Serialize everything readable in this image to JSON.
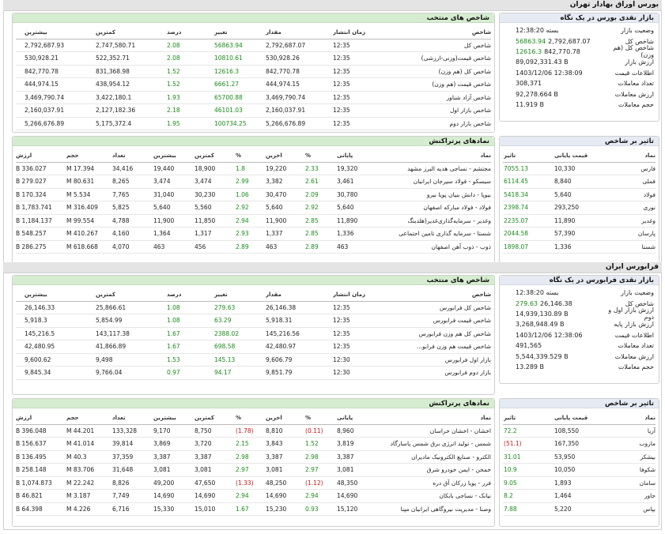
{
  "bourse": {
    "title": "بورس اوراق بهادار تهران",
    "market": {
      "title": "بازار نقدی بورس در یک نگاه",
      "rows": [
        {
          "label": "وضعیت بازار",
          "value": "بسته 12:38:20"
        },
        {
          "label": "شاخص کل",
          "value": "2,792,687.07",
          "change": "56863.94"
        },
        {
          "label": "شاخص کل (هم وزن)",
          "value": "842,770.78",
          "change": "12616.3"
        },
        {
          "label": "ارزش بازار",
          "value": "89,092,331.43 B"
        },
        {
          "label": "اطلاعات قیمت",
          "value": "1403/12/06 12:38:09"
        },
        {
          "label": "تعداد معاملات",
          "value": "308,371"
        },
        {
          "label": "ارزش معاملات",
          "value": "92,278.664 B"
        },
        {
          "label": "حجم معاملات",
          "value": "11.919 B"
        }
      ]
    },
    "indices": {
      "title": "شاخص های منتخب",
      "headers": [
        "شاخص",
        "زمان انتشار",
        "مقدار",
        "تغییر",
        "درصد",
        "کمترین",
        "بیشترین"
      ],
      "rows": [
        [
          "شاخص کل",
          "12:35",
          "2,792,687.07",
          "56863.94",
          "2.08",
          "2,747,580.71",
          "2,792,687.93"
        ],
        [
          "شاخص قیمت(وزنی-ارزشی)",
          "12:35",
          "530,928.26",
          "10810.61",
          "2.08",
          "522,352.71",
          "530,928.21"
        ],
        [
          "شاخص کل (هم وزن)",
          "12:35",
          "842,770.78",
          "12616.3",
          "1.52",
          "831,368.98",
          "842,770.78"
        ],
        [
          "شاخص قیمت (هم وزن)",
          "12:35",
          "444,974.15",
          "6661.27",
          "1.52",
          "438,954.12",
          "444,974.15"
        ],
        [
          "شاخص آزاد شناور",
          "12:35",
          "3,469,790.74",
          "65700.88",
          "1.93",
          "3,422,180.1",
          "3,469,790.74"
        ],
        [
          "شاخص بازار اول",
          "12:35",
          "2,160,037.91",
          "46101.03",
          "2.18",
          "2,127,182.36",
          "2,160,037.91"
        ],
        [
          "شاخص بازار دوم",
          "12:35",
          "5,266,676.89",
          "100734.25",
          "1.95",
          "5,175,372.4",
          "5,266,676.89"
        ]
      ]
    },
    "impact": {
      "title": "تاثیر بر شاخص",
      "headers": [
        "نماد",
        "قیمت پایانی",
        "تاثیر"
      ],
      "rows": [
        [
          "فارس",
          "10,330",
          "7055.13"
        ],
        [
          "فملی",
          "8,840",
          "6114.45"
        ],
        [
          "فولاد",
          "5,640",
          "5418.34"
        ],
        [
          "نوری",
          "293,250",
          "2398.74"
        ],
        [
          "وغدیر",
          "11,890",
          "2235.07"
        ],
        [
          "پارسان",
          "57,390",
          "2044.58"
        ],
        [
          "شستا",
          "1,336",
          "1898.07"
        ]
      ]
    },
    "popular": {
      "title": "نمادهای پرتراکنش",
      "headers": [
        "نماد",
        "پایانی",
        "%",
        "آخرین",
        "%",
        "کمترین",
        "بیشترین",
        "تعداد",
        "حجم",
        "ارزش"
      ],
      "rows": [
        [
          "مجتشم - نساجی هدیه البرز مشهد",
          "19,320",
          "2.33",
          "19,220",
          "1.8",
          "18,900",
          "19,440",
          "34,416",
          "17.394 M",
          "336.027 B"
        ],
        [
          "سیسکو - فولاد سیرجان ایرانیان",
          "3,461",
          "2.61",
          "3,382",
          "2.99",
          "3,474",
          "3,474",
          "8,265",
          "80.631 M",
          "279.027 B"
        ],
        [
          "بیوپا - دانش بنیان پویا نیرو",
          "30,780",
          "2.09",
          "30,470",
          "1.06",
          "30,230",
          "31,040",
          "7,765",
          "5.534 M",
          "170.324 B"
        ],
        [
          "فولاد - فولاد مبارکه اصفهان",
          "5,640",
          "2.92",
          "5,640",
          "2.92",
          "5,560",
          "5,640",
          "5,825",
          "316.409 M",
          "1,783.741 B"
        ],
        [
          "وغدیر - سرمایه‌گذاری‌غدیر(هلدینگ",
          "11,890",
          "2.85",
          "11,900",
          "2.94",
          "11,850",
          "11,900",
          "4,788",
          "99.554 M",
          "1,184.137 B"
        ],
        [
          "شستا - سرمایه گذاری تامین اجتماعی",
          "1,336",
          "2.85",
          "1,337",
          "2.93",
          "1,317",
          "1,364",
          "4,160",
          "410.267 M",
          "548.257 B"
        ],
        [
          "ذوب - ذوب آهن اصفهان",
          "463",
          "2.89",
          "463",
          "2.89",
          "456",
          "463",
          "4,070",
          "618.668 M",
          "286.275 B"
        ]
      ]
    }
  },
  "farabourse": {
    "title": "فرابورس ایران",
    "market": {
      "title": "بازار نقدی فرابورس در یک نگاه",
      "rows": [
        {
          "label": "وضعیت بازار",
          "value": "بسته 12:38:20"
        },
        {
          "label": "شاخص کل",
          "value": "26,146.38",
          "change": "279.63"
        },
        {
          "label": "ارزش بازار اول و دوم",
          "value": "14,939,130.89 B"
        },
        {
          "label": "ارزش بازار پایه",
          "value": "3,268,948.49 B"
        },
        {
          "label": "اطلاعات قیمت",
          "value": "1403/12/06 12:38:06"
        },
        {
          "label": "تعداد معاملات",
          "value": "491,565"
        },
        {
          "label": "ارزش معاملات",
          "value": "5,544,339.529 B"
        },
        {
          "label": "حجم معاملات",
          "value": "13.289 B"
        }
      ]
    },
    "indices": {
      "title": "شاخص های منتخب",
      "headers": [
        "شاخص",
        "زمان انتشار",
        "مقدار",
        "تغییر",
        "درصد",
        "کمترین",
        "بیشترین"
      ],
      "rows": [
        [
          "شاخص کل فرابورس",
          "12:35",
          "26,146.38",
          "279.63",
          "1.08",
          "25,866.61",
          "26,146.33"
        ],
        [
          "شاخص قیمت فرابورس",
          "12:35",
          "5,918.31",
          "63.29",
          "1.08",
          "5,854.99",
          "5,918.3"
        ],
        [
          "شاخص کل هم وزن فرابورس",
          "12:35",
          "145,216.56",
          "2388.02",
          "1.67",
          "143,117.38",
          "145,216.5"
        ],
        [
          "شاخص قیمت هم وزن فرابو...",
          "12:35",
          "42,480.97",
          "698.58",
          "1.67",
          "41,866.89",
          "42,480.95"
        ],
        [
          "بازار اول فرابورس",
          "12:30",
          "9,606.79",
          "145.13",
          "1.53",
          "9,498",
          "9,600.62"
        ],
        [
          "بازار دوم فرابورس",
          "12:30",
          "9,851.79",
          "94.17",
          "0.97",
          "9,766.04",
          "9,845.34"
        ]
      ]
    },
    "impact": {
      "title": "تاثیر بر شاخص",
      "headers": [
        "نماد",
        "قیمت پایانی",
        "تاثیر"
      ],
      "rows": [
        [
          "آریا",
          "108,550",
          "72.2"
        ],
        [
          "ماروب",
          "167,350",
          "(51.1)"
        ],
        [
          "بیشکر",
          "53,950",
          "31.01"
        ],
        [
          "شکوفا",
          "10,050",
          "10.9"
        ],
        [
          "سامان",
          "1,893",
          "9.05"
        ],
        [
          "حاور",
          "1,464",
          "8.2"
        ],
        [
          "بپاس",
          "5,220",
          "7.88"
        ]
      ]
    },
    "popular": {
      "title": "نمادهای پرتراکنش",
      "headers": [
        "نماد",
        "پایانی",
        "%",
        "آخرین",
        "%",
        "کمترین",
        "بیشترین",
        "تعداد",
        "حجم",
        "ارزش"
      ],
      "rows": [
        [
          "اخشان - اخشان خراسان",
          "8,960",
          "(0.11)",
          "8,810",
          "(1.78)",
          "8,750",
          "9,170",
          "133,328",
          "44.201 M",
          "396.048 B"
        ],
        [
          "شمس - تولید انرژی برق شمس پاسارگاد",
          "3,819",
          "1.52",
          "3,843",
          "2.15",
          "3,720",
          "3,869",
          "39,814",
          "41.014 M",
          "156.637 B"
        ],
        [
          "الکترو - صنایع الکترونیک مادیران",
          "3,387",
          "2.98",
          "3,387",
          "2.98",
          "3,387",
          "3,387",
          "37,359",
          "40.3 M",
          "136.495 B"
        ],
        [
          "خمحن - ایمن خودرو شرق",
          "3,081",
          "2.97",
          "3,081",
          "2.97",
          "3,081",
          "3,081",
          "31,648",
          "83.706 M",
          "258.148 B"
        ],
        [
          "فرر - پویا زرکان آق دره",
          "48,350",
          "(1.12)",
          "48,250",
          "(1.33)",
          "47,650",
          "49,200",
          "8,826",
          "22.242 M",
          "1,074.873 B"
        ],
        [
          "نیانک - نساجی بابکان",
          "14,690",
          "2.94",
          "14,690",
          "2.94",
          "14,690",
          "14,690",
          "7,749",
          "3.187 M",
          "46.821 B"
        ],
        [
          "وصنا - مدیریت نیروگاهی ایرانیان مپنا",
          "15,120",
          "0.93",
          "15,230",
          "1.67",
          "15,010",
          "15,330",
          "6,716",
          "4.226 M",
          "64.398 B"
        ]
      ]
    }
  }
}
